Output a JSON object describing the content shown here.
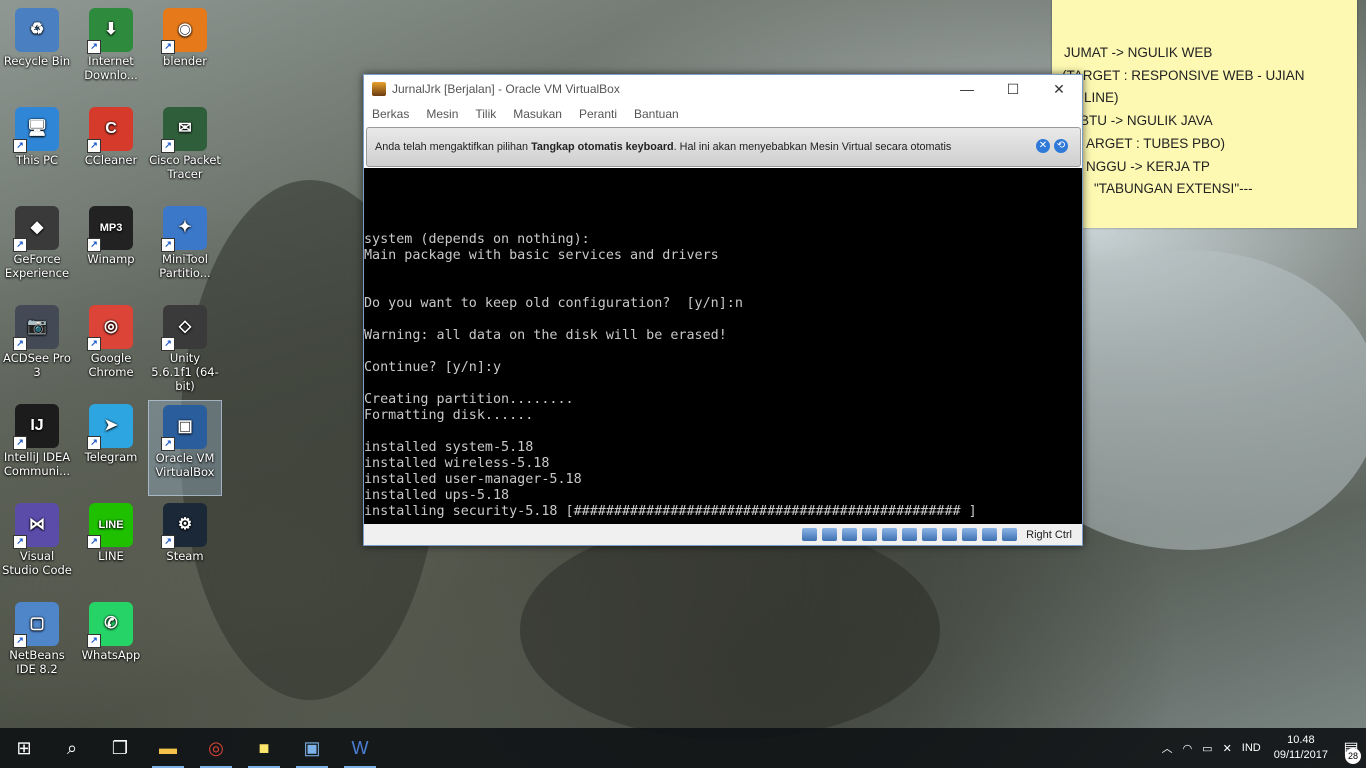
{
  "desktop_icons": [
    {
      "label": "Recycle Bin",
      "icon": "recycle-bin-icon",
      "color": "#4a7fc1",
      "glyph": "♻"
    },
    {
      "label": "Internet Downlo...",
      "icon": "internet-download-manager-icon",
      "color": "#2e8b3d",
      "glyph": "⬇"
    },
    {
      "label": "blender",
      "icon": "blender-icon",
      "color": "#e67a1a",
      "glyph": "◉"
    },
    {
      "label": "This PC",
      "icon": "this-pc-icon",
      "color": "#2f86d6",
      "glyph": "🖥"
    },
    {
      "label": "CCleaner",
      "icon": "ccleaner-icon",
      "color": "#d63a2a",
      "glyph": "C"
    },
    {
      "label": "Cisco Packet Tracer",
      "icon": "cisco-packet-tracer-icon",
      "color": "#2e5e3a",
      "glyph": "✉"
    },
    {
      "label": "GeForce Experience",
      "icon": "geforce-experience-icon",
      "color": "#3a3a3a",
      "glyph": "◆"
    },
    {
      "label": "Winamp",
      "icon": "winamp-icon",
      "color": "#222222",
      "glyph": "MP3"
    },
    {
      "label": "MiniTool Partitio...",
      "icon": "minitool-partition-icon",
      "color": "#3b78c9",
      "glyph": "✦"
    },
    {
      "label": "ACDSee Pro 3",
      "icon": "acdsee-icon",
      "color": "#444a55",
      "glyph": "📷"
    },
    {
      "label": "Google Chrome",
      "icon": "chrome-icon",
      "color": "#db4437",
      "glyph": "◎"
    },
    {
      "label": "Unity 5.6.1f1 (64-bit)",
      "icon": "unity-icon",
      "color": "#3a3a3a",
      "glyph": "◇"
    },
    {
      "label": "IntelliJ IDEA Communi...",
      "icon": "intellij-icon",
      "color": "#1c1c1c",
      "glyph": "IJ"
    },
    {
      "label": "Telegram",
      "icon": "telegram-icon",
      "color": "#2ca5e0",
      "glyph": "➤"
    },
    {
      "label": "Oracle VM VirtualBox",
      "icon": "virtualbox-icon",
      "color": "#2a5d9c",
      "glyph": "▣"
    },
    {
      "label": "Visual Studio Code",
      "icon": "vscode-icon",
      "color": "#5b4caa",
      "glyph": "⋈"
    },
    {
      "label": "LINE",
      "icon": "line-icon",
      "color": "#1ec000",
      "glyph": "LINE"
    },
    {
      "label": "Steam",
      "icon": "steam-icon",
      "color": "#1b2838",
      "glyph": "⚙"
    },
    {
      "label": "NetBeans IDE 8.2",
      "icon": "netbeans-icon",
      "color": "#4f86c9",
      "glyph": "▢"
    },
    {
      "label": "WhatsApp",
      "icon": "whatsapp-icon",
      "color": "#25d366",
      "glyph": "✆"
    }
  ],
  "sticky_note": {
    "lines": [
      "JUMAT -> NGULIK WEB",
      "(TARGET : RESPONSIVE WEB - UJIAN",
      "LINE)",
      "BTU -> NGULIK JAVA",
      "ARGET : TUBES PBO)",
      "NGGU -> KERJA TP",
      "\"TABUNGAN EXTENSI\"---"
    ]
  },
  "vbox": {
    "title": "JurnalJrk [Berjalan] - Oracle VM VirtualBox",
    "menu": [
      "Berkas",
      "Mesin",
      "Tilik",
      "Masukan",
      "Peranti",
      "Bantuan"
    ],
    "notice_pre": "Anda telah mengaktifkan pilihan ",
    "notice_bold": "Tangkap otomatis keyboard",
    "notice_post": ". Hal ini akan menyebabkan Mesin Virtual secara otomatis",
    "console_lines": [
      "",
      "",
      "",
      "",
      "system (depends on nothing):",
      "Main package with basic services and drivers",
      "",
      "",
      "Do you want to keep old configuration?  [y/n]:n",
      "",
      "Warning: all data on the disk will be erased!",
      "",
      "Continue? [y/n]:y",
      "",
      "Creating partition........",
      "Formatting disk......",
      "",
      "installed system-5.18",
      "installed wireless-5.18",
      "installed user-manager-5.18",
      "installed ups-5.18",
      "installing security-5.18 [################################################ ]"
    ],
    "host_key": "Right Ctrl"
  },
  "taskbar": {
    "apps": [
      "file-explorer-icon",
      "chrome-icon",
      "sticky-notes-icon",
      "virtualbox-icon",
      "word-icon"
    ],
    "language": "IND",
    "time": "10.48",
    "date": "09/11/2017",
    "notification_count": "28"
  }
}
